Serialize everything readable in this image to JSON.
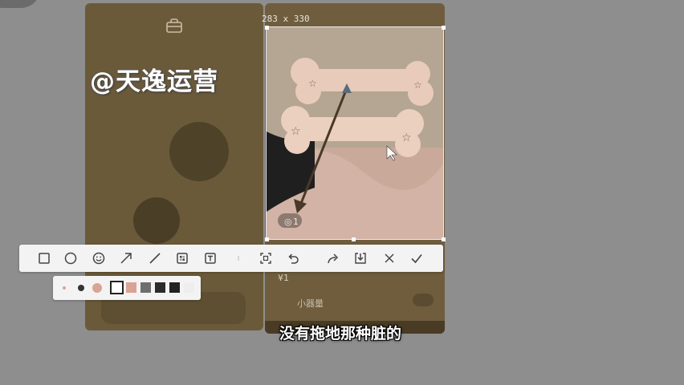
{
  "watermark": "@天逸运营",
  "selection": {
    "size_label": "283 x 330"
  },
  "background": {
    "caption": "",
    "row_label": "小器量",
    "row_number": "¥1"
  },
  "capture": {
    "counter_text": "1"
  },
  "toolbar": {
    "tools": [
      {
        "name": "rectangle-tool",
        "icon": "rectangle-icon"
      },
      {
        "name": "ellipse-tool",
        "icon": "circle-icon"
      },
      {
        "name": "emoji-tool",
        "icon": "smiley-icon"
      },
      {
        "name": "arrow-tool",
        "icon": "arrow-icon"
      },
      {
        "name": "line-tool",
        "icon": "line-icon"
      },
      {
        "name": "mosaic-tool",
        "icon": "mosaic-icon"
      },
      {
        "name": "text-tool",
        "icon": "text-icon"
      },
      {
        "name": "ocr-tool",
        "icon": "scan-icon"
      },
      {
        "name": "undo-button",
        "icon": "undo-icon"
      },
      {
        "name": "share-button",
        "icon": "share-icon"
      },
      {
        "name": "download-button",
        "icon": "download-icon"
      },
      {
        "name": "cancel-button",
        "icon": "close-icon"
      },
      {
        "name": "confirm-button",
        "icon": "check-icon"
      }
    ]
  },
  "style_bar": {
    "sizes": [
      "small",
      "medium",
      "large"
    ],
    "selected_size": "large",
    "colors": [
      "#ffffff",
      "#d9a493",
      "#6e6e6e",
      "#2b2b2b",
      "#222222"
    ],
    "selected_color": "#ffffff"
  },
  "subtitle": "没有拖地那种脏的"
}
